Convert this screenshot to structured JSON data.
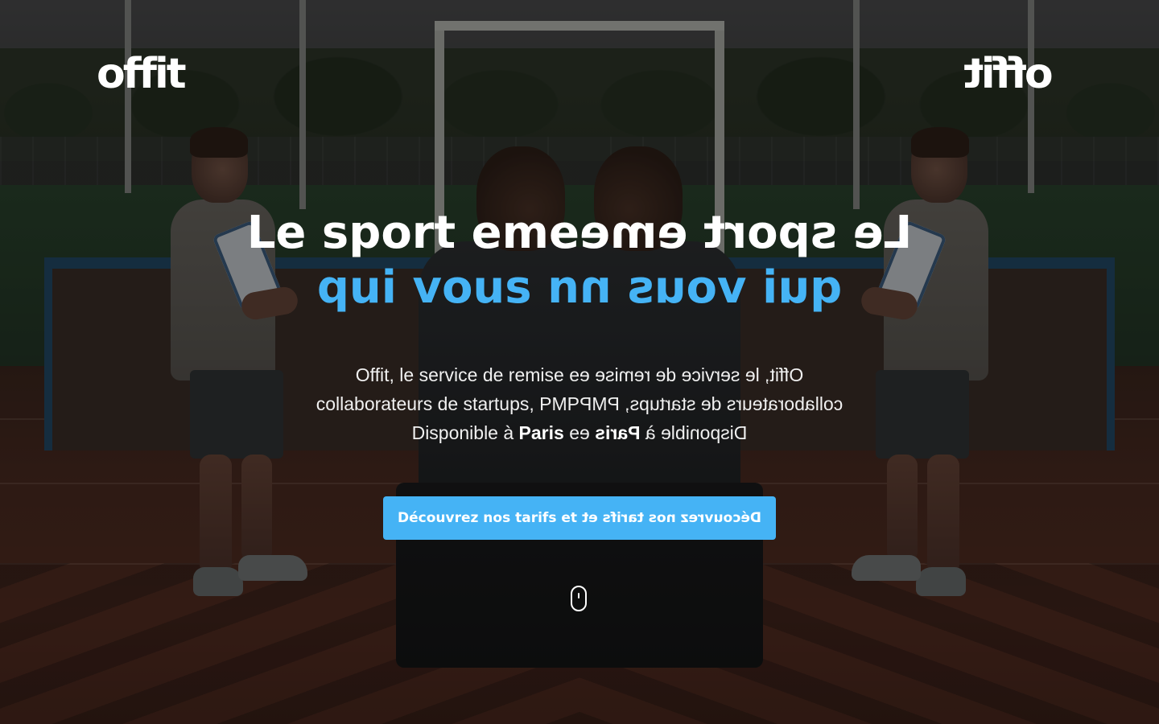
{
  "brand": {
    "logo_text": "offit"
  },
  "hero": {
    "title_line1": "Le sport eme",
    "title_line2": "qui vous n",
    "description": {
      "line1": "Offit, le service de remise e",
      "line2": "collaborateurs de startups, PMP",
      "line3_prefix": "Disponible à ",
      "line3_city": "Paris",
      "line3_suffix": " e"
    },
    "cta_label": "Découvrez nos tarifs et re"
  },
  "scroll_indicator": {
    "icon": "mouse-scroll-icon"
  },
  "colors": {
    "accent": "#45b3f5",
    "text": "#ffffff"
  }
}
